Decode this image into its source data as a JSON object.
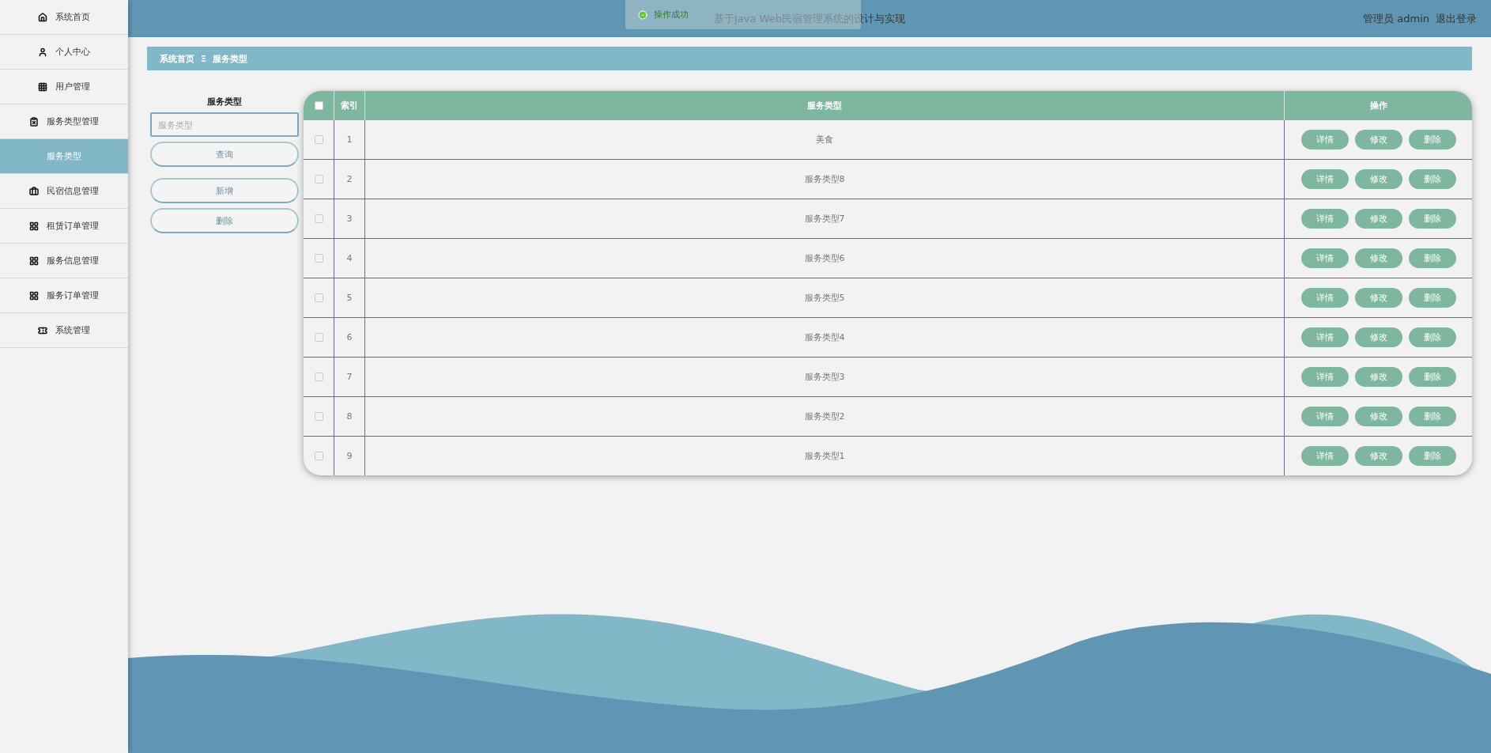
{
  "sidebar": {
    "items": [
      {
        "label": "系统首页",
        "selected": false
      },
      {
        "label": "个人中心",
        "selected": false
      },
      {
        "label": "用户管理",
        "selected": false
      },
      {
        "label": "服务类型管理",
        "selected": false
      },
      {
        "label": "服务类型",
        "selected": true
      },
      {
        "label": "民宿信息管理",
        "selected": false
      },
      {
        "label": "租赁订单管理",
        "selected": false
      },
      {
        "label": "服务信息管理",
        "selected": false
      },
      {
        "label": "服务订单管理",
        "selected": false
      },
      {
        "label": "系统管理",
        "selected": false
      }
    ]
  },
  "header": {
    "title": "基于Java Web民宿管理系统的设计与实现",
    "user": "管理员 admin",
    "logout": "退出登录"
  },
  "toast": {
    "message": "操作成功"
  },
  "breadcrumb": {
    "home": "系统首页",
    "separator": "Ξ",
    "current": "服务类型"
  },
  "search": {
    "label": "服务类型",
    "placeholder": "服务类型",
    "buttons": [
      "查询",
      "新增",
      "删除"
    ]
  },
  "table": {
    "header_checkbox": {
      "checked": false
    },
    "columns": [
      "索引",
      "服务类型",
      "操作"
    ],
    "rows": [
      {
        "checked": false,
        "index": "1",
        "type": "美食",
        "actions": [
          "详情",
          "修改",
          "删除"
        ]
      },
      {
        "checked": false,
        "index": "2",
        "type": "服务类型8",
        "actions": [
          "详情",
          "修改",
          "删除"
        ]
      },
      {
        "checked": false,
        "index": "3",
        "type": "服务类型7",
        "actions": [
          "详情",
          "修改",
          "删除"
        ]
      },
      {
        "checked": false,
        "index": "4",
        "type": "服务类型6",
        "actions": [
          "详情",
          "修改",
          "删除"
        ]
      },
      {
        "checked": false,
        "index": "5",
        "type": "服务类型5",
        "actions": [
          "详情",
          "修改",
          "删除"
        ]
      },
      {
        "checked": false,
        "index": "6",
        "type": "服务类型4",
        "actions": [
          "详情",
          "修改",
          "删除"
        ]
      },
      {
        "checked": false,
        "index": "7",
        "type": "服务类型3",
        "actions": [
          "详情",
          "修改",
          "删除"
        ]
      },
      {
        "checked": false,
        "index": "8",
        "type": "服务类型2",
        "actions": [
          "详情",
          "修改",
          "删除"
        ]
      },
      {
        "checked": false,
        "index": "9",
        "type": "服务类型1",
        "actions": [
          "详情",
          "修改",
          "删除"
        ]
      }
    ]
  }
}
